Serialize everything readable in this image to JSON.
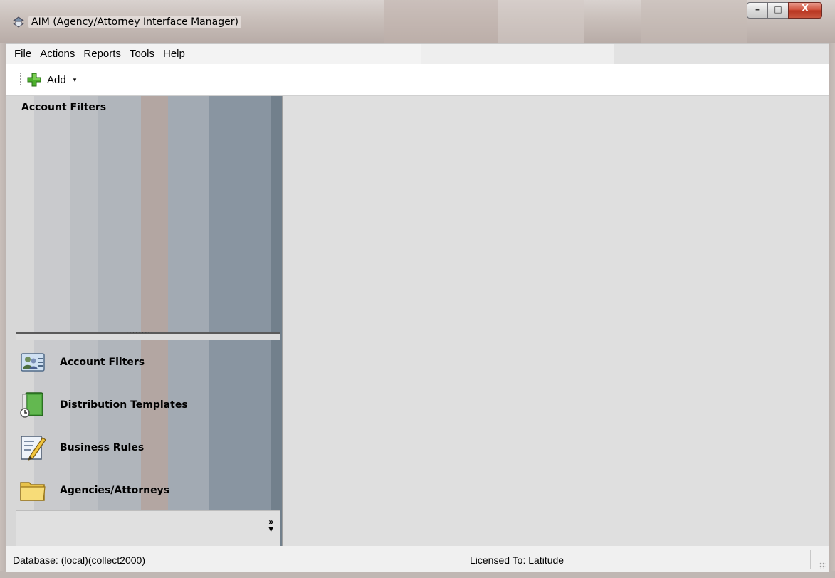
{
  "window": {
    "title": "AIM  (Agency/Attorney Interface Manager)",
    "controls": {
      "minimize": "–",
      "maximize": "□",
      "close": "X"
    }
  },
  "menu": {
    "items": [
      {
        "hotkey": "F",
        "rest": "ile"
      },
      {
        "hotkey": "A",
        "rest": "ctions"
      },
      {
        "hotkey": "R",
        "rest": "eports"
      },
      {
        "hotkey": "T",
        "rest": "ools"
      },
      {
        "hotkey": "H",
        "rest": "elp"
      }
    ]
  },
  "toolbar": {
    "add_label": "Add",
    "add_icon": "green-plus-icon",
    "dropdown_caret": "▾"
  },
  "sidebar": {
    "header": "Account Filters",
    "splitter_dots": "․․․․․․․․․",
    "nav_items": [
      {
        "label": "Account Filters",
        "icon": "people-card-icon"
      },
      {
        "label": "Distribution Templates",
        "icon": "green-book-clock-icon"
      },
      {
        "label": "Business Rules",
        "icon": "pencil-document-icon"
      },
      {
        "label": "Agencies/Attorneys",
        "icon": "folder-icon"
      }
    ],
    "overflow_chevron": "»"
  },
  "statusbar": {
    "database": "Database: (local)(collect2000)",
    "licensed": "Licensed To: Latitude"
  },
  "colors": {
    "content_bg": "#dfdfdf",
    "sidebar_bands": [
      "#d0d0d0",
      "#c2c4c8",
      "#b5b8bd",
      "#b2a5a1",
      "#a3aab2",
      "#8a959f",
      "#7d8a95"
    ],
    "close_button": "#c9563f"
  }
}
